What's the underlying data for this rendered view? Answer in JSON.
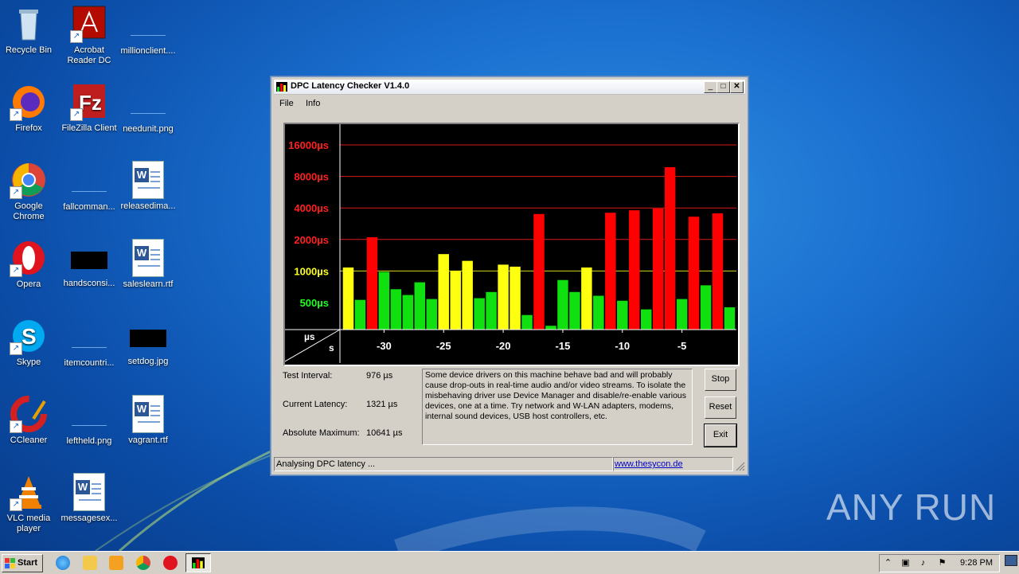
{
  "desktop": {
    "icons": [
      {
        "label": "Recycle Bin"
      },
      {
        "label": "Acrobat Reader DC"
      },
      {
        "label": "millionclient...."
      },
      {
        "label": "Firefox"
      },
      {
        "label": "FileZilla Client"
      },
      {
        "label": "needunit.png"
      },
      {
        "label": "Google Chrome"
      },
      {
        "label": "fallcomman..."
      },
      {
        "label": "releasedima..."
      },
      {
        "label": "Opera"
      },
      {
        "label": "handsconsi..."
      },
      {
        "label": "saleslearn.rtf"
      },
      {
        "label": "Skype"
      },
      {
        "label": "itemcountri..."
      },
      {
        "label": "setdog.jpg"
      },
      {
        "label": "CCleaner"
      },
      {
        "label": "leftheld.png"
      },
      {
        "label": "vagrant.rtf"
      },
      {
        "label": "VLC media player"
      },
      {
        "label": "messagesex..."
      }
    ]
  },
  "window": {
    "title": "DPC Latency Checker V1.4.0",
    "menu": [
      "File",
      "Info"
    ],
    "fields": {
      "test_interval_label": "Test Interval:",
      "test_interval_value": "976 µs",
      "current_latency_label": "Current Latency:",
      "current_latency_value": "1321 µs",
      "absolute_max_label": "Absolute Maximum:",
      "absolute_max_value": "10641 µs"
    },
    "message": "Some device drivers on this machine behave bad and will probably cause drop-outs in real-time audio and/or video streams. To isolate the misbehaving driver use Device Manager and disable/re-enable various devices, one at a time. Try network and W-LAN adapters, modems, internal sound devices, USB host controllers, etc.",
    "buttons": {
      "stop": "Stop",
      "reset": "Reset",
      "exit": "Exit"
    },
    "status": {
      "left": "Analysing DPC latency ...",
      "link": "www.thesycon.de"
    }
  },
  "chart_data": {
    "type": "bar",
    "y_scale": "log",
    "y_tick_labels": [
      "16000µs",
      "8000µs",
      "4000µs",
      "2000µs",
      "1000µs",
      "500µs"
    ],
    "y_tick_values": [
      16000,
      8000,
      4000,
      2000,
      1000,
      500
    ],
    "y_tick_colors": [
      "#ff2020",
      "#ff2020",
      "#ff2020",
      "#ff2020",
      "#ffff20",
      "#20ff20"
    ],
    "x_tick_labels": [
      "-30",
      "-25",
      "-20",
      "-15",
      "-10",
      "-5"
    ],
    "x_tick_values": [
      -30,
      -25,
      -20,
      -15,
      -10,
      -5
    ],
    "corner_labels": {
      "y_unit": "µs",
      "x_unit": "s"
    },
    "x": [
      -33,
      -32,
      -31,
      -30,
      -29,
      -28,
      -27,
      -26,
      -25,
      -24,
      -23,
      -22,
      -21,
      -20,
      -19,
      -18,
      -17,
      -16,
      -15,
      -14,
      -13,
      -12,
      -11,
      -10,
      -9,
      -8,
      -7,
      -6,
      -5,
      -4,
      -3,
      -2,
      -1
    ],
    "values": [
      1080,
      530,
      2100,
      980,
      670,
      590,
      780,
      540,
      1450,
      1000,
      1250,
      550,
      630,
      1150,
      1100,
      380,
      3500,
      300,
      820,
      630,
      1080,
      580,
      3600,
      520,
      3800,
      430,
      3950,
      9800,
      540,
      3300,
      730,
      3550,
      450
    ],
    "colors": {
      "green": "#10e010",
      "yellow": "#ffff10",
      "red": "#ff0000"
    }
  },
  "taskbar": {
    "start": "Start",
    "clock": "9:28 PM"
  },
  "watermark": "ANY RUN"
}
